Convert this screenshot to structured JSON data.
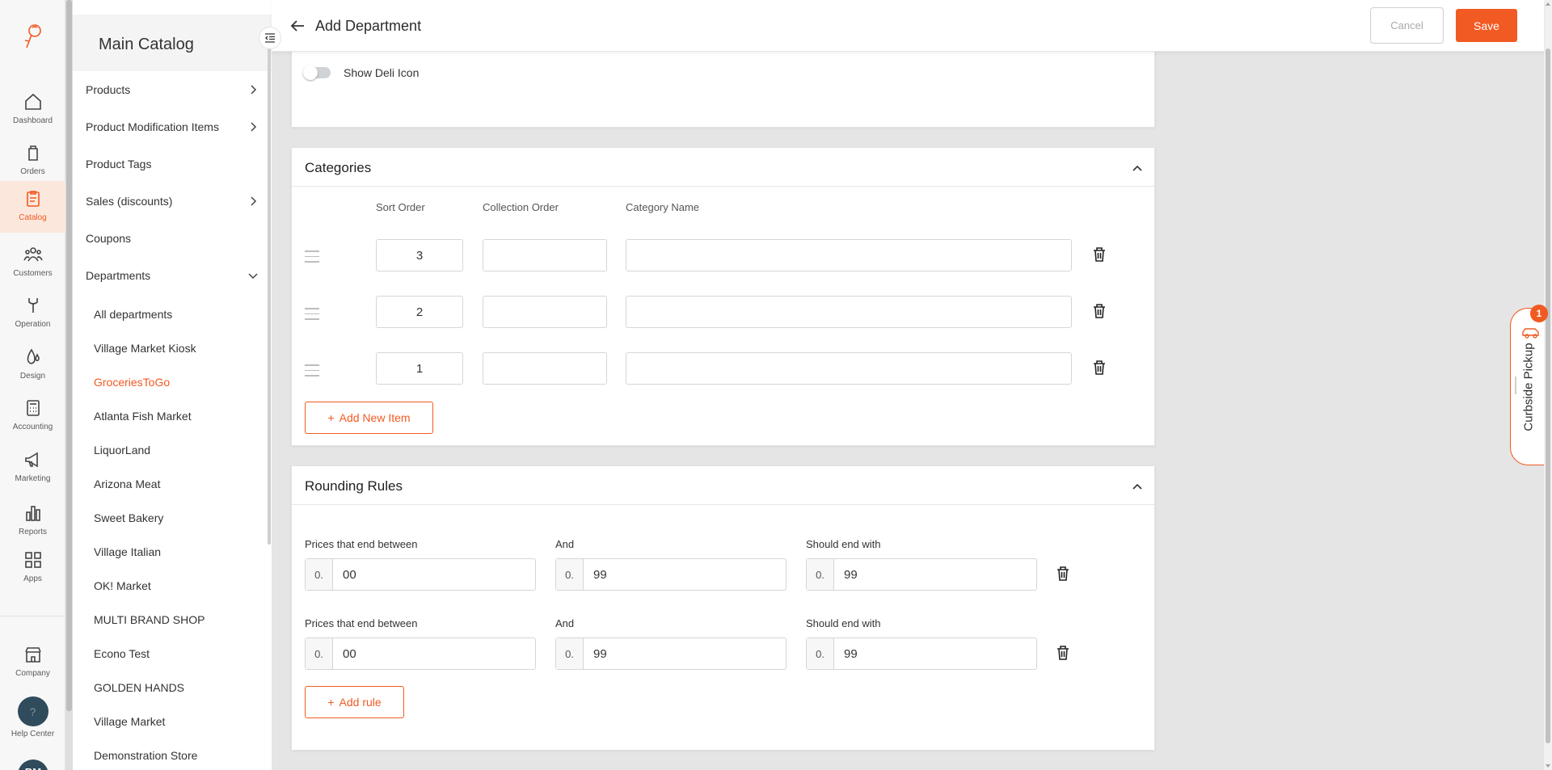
{
  "rail": {
    "items": [
      {
        "label": "Dashboard",
        "icon": "home-icon"
      },
      {
        "label": "Orders",
        "icon": "bag-icon"
      },
      {
        "label": "Catalog",
        "icon": "clipboard-icon"
      },
      {
        "label": "Customers",
        "icon": "users-icon"
      },
      {
        "label": "Operation",
        "icon": "wrench-icon"
      },
      {
        "label": "Design",
        "icon": "drops-icon"
      },
      {
        "label": "Accounting",
        "icon": "calculator-icon"
      },
      {
        "label": "Marketing",
        "icon": "megaphone-icon"
      },
      {
        "label": "Reports",
        "icon": "bar-chart-icon"
      },
      {
        "label": "Apps",
        "icon": "grid-icon"
      }
    ],
    "company": "Company",
    "help": "Help Center",
    "help_glyph": "?",
    "avatar": "BM",
    "active_color": "#f15a22"
  },
  "catalog": {
    "title": "Main Catalog",
    "items": [
      {
        "label": "Products"
      },
      {
        "label": "Product Modification Items"
      },
      {
        "label": "Product Tags"
      },
      {
        "label": "Sales (discounts)"
      },
      {
        "label": "Coupons"
      },
      {
        "label": "Departments"
      }
    ],
    "departments": [
      "All departments",
      "Village Market Kiosk",
      "GroceriesToGo",
      "Atlanta Fish Market",
      "LiquorLand",
      "Arizona Meat",
      "Sweet Bakery",
      "Village Italian",
      "OK! Market",
      "MULTI BRAND SHOP",
      "Econo Test",
      "GOLDEN HANDS",
      "Village Market",
      "Demonstration Store"
    ],
    "active_department": "GroceriesToGo"
  },
  "header": {
    "title": "Add Department",
    "cancel": "Cancel",
    "save": "Save"
  },
  "deli": {
    "label": "Show Deli Icon",
    "enabled": false
  },
  "categories": {
    "title": "Categories",
    "columns": {
      "sort": "Sort Order",
      "collection": "Collection Order",
      "name": "Category Name"
    },
    "rows": [
      {
        "sort": "3",
        "collection": "",
        "name": ""
      },
      {
        "sort": "2",
        "collection": "",
        "name": ""
      },
      {
        "sort": "1",
        "collection": "",
        "name": ""
      }
    ],
    "add_button": "Add New Item"
  },
  "rounding": {
    "title": "Rounding Rules",
    "labels": {
      "between": "Prices that end between",
      "and": "And",
      "end_with": "Should end with"
    },
    "prefix": "0.",
    "rules": [
      {
        "from": "00",
        "to": "99",
        "end": "99"
      },
      {
        "from": "00",
        "to": "99",
        "end": "99"
      }
    ],
    "add_button": "Add rule"
  },
  "curbside": {
    "label": "Curbside Pickup",
    "badge": "1"
  },
  "colors": {
    "accent": "#f15a22",
    "background": "#e5e5e5"
  }
}
